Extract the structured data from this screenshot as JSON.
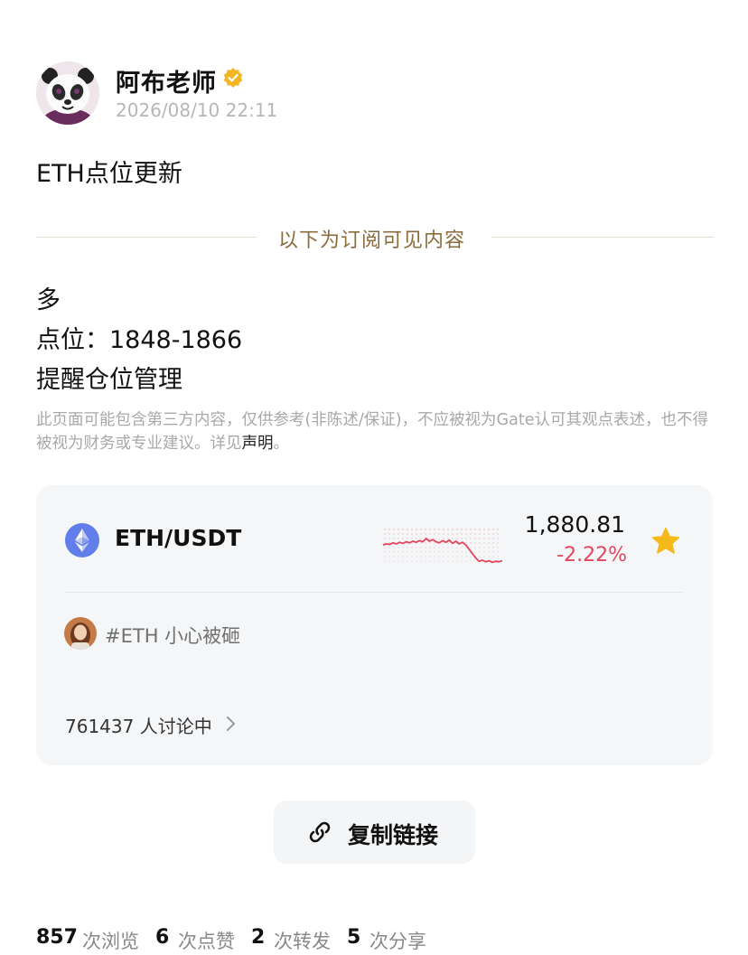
{
  "post": {
    "author": "阿布老师",
    "timestamp": "2026/08/10 22:11",
    "title": "ETH点位更新",
    "divider_text": "以下为订阅可见内容",
    "body": [
      "多",
      "点位：1848-1866",
      "提醒仓位管理"
    ],
    "disclaimer": "此页面可能包含第三方内容，仅供参考(非陈述/保证)，不应被视为Gate认可其观点表述，也不得被视为财务或专业建议。详见",
    "disclaimer_link": "声明",
    "disclaimer_end": "。"
  },
  "ticker": {
    "pair": "ETH/USDT",
    "price": "1,880.81",
    "change": "-2.22%",
    "trend_color": "#e2465e",
    "sparkline": [
      0.62,
      0.6,
      0.61,
      0.58,
      0.6,
      0.57,
      0.59,
      0.56,
      0.58,
      0.55,
      0.57,
      0.54,
      0.56,
      0.5,
      0.55,
      0.52,
      0.56,
      0.58,
      0.54,
      0.57,
      0.53,
      0.59,
      0.55,
      0.6,
      0.57,
      0.62,
      0.7,
      0.78,
      0.86,
      0.92,
      0.9,
      0.93,
      0.91,
      0.94,
      0.92,
      0.93,
      0.91
    ]
  },
  "topic": {
    "text": "#ETH 小心被砸",
    "discussing": "761437 人讨论中"
  },
  "actions": {
    "copy_link": "复制链接"
  },
  "stats": {
    "views": "857",
    "views_label": "次浏览",
    "likes": "6",
    "likes_label": "次点赞",
    "reposts": "2",
    "reposts_label": "次转发",
    "shares": "5",
    "shares_label": "次分享"
  },
  "colors": {
    "accent_gold": "#8a6c3c",
    "negative": "#e2465e",
    "star": "#f5b91a",
    "eth": "#627eea"
  }
}
